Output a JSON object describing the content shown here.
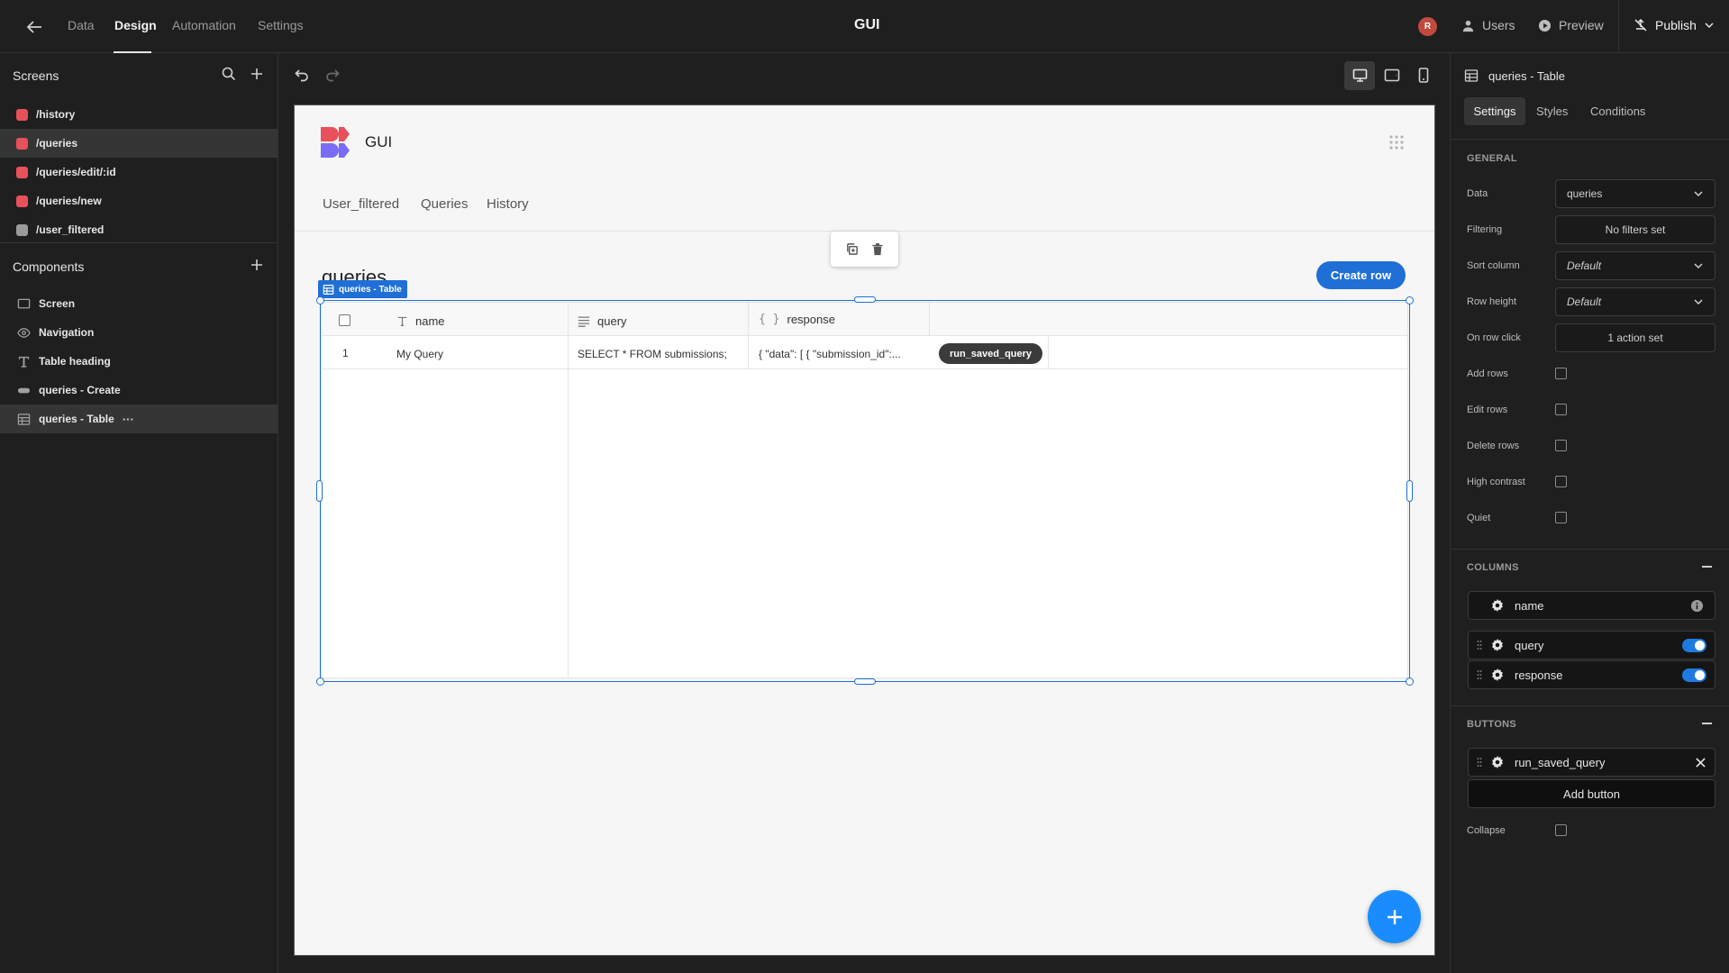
{
  "topbar": {
    "tabs": [
      "Data",
      "Design",
      "Automation",
      "Settings"
    ],
    "title": "GUI",
    "avatar": "R",
    "users": "Users",
    "preview": "Preview",
    "publish": "Publish"
  },
  "screens": {
    "title": "Screens",
    "items": [
      "/history",
      "/queries",
      "/queries/edit/:id",
      "/queries/new",
      "/user_filtered"
    ],
    "colors": [
      "#e8505b",
      "#e8505b",
      "#e8505b",
      "#e8505b",
      "#9a9a9a"
    ]
  },
  "components": {
    "title": "Components",
    "items": [
      "Screen",
      "Navigation",
      "Table heading",
      "queries - Create",
      "queries - Table"
    ],
    "more": "···"
  },
  "app": {
    "name": "GUI",
    "nav": [
      "User_filtered",
      "Queries",
      "History"
    ],
    "heading": "queries",
    "create_row": "Create row",
    "selection_tag": "queries - Table",
    "table": {
      "headers": [
        "name",
        "query",
        "response"
      ],
      "rows": [
        {
          "index": "1",
          "name": "My Query",
          "query": "SELECT * FROM submissions;",
          "response": "{ \"data\": [ { \"submission_id\":...",
          "button": "run_saved_query"
        }
      ]
    }
  },
  "panel": {
    "title": "queries - Table",
    "tabs": [
      "Settings",
      "Styles",
      "Conditions"
    ],
    "general": "GENERAL",
    "labels": {
      "data": "Data",
      "filtering": "Filtering",
      "sort_column": "Sort column",
      "row_height": "Row height",
      "on_row_click": "On row click",
      "add_rows": "Add rows",
      "edit_rows": "Edit rows",
      "delete_rows": "Delete rows",
      "high_contrast": "High contrast",
      "quiet": "Quiet",
      "collapse": "Collapse"
    },
    "values": {
      "data": "queries",
      "filtering": "No filters set",
      "sort_column": "Default",
      "row_height": "Default",
      "on_row_click": "1 action set"
    },
    "columns_title": "COLUMNS",
    "columns": [
      "name",
      "query",
      "response"
    ],
    "buttons_title": "BUTTONS",
    "buttons": [
      "run_saved_query"
    ],
    "add_button": "Add button"
  },
  "colors": {
    "accent": "#1f7ae0",
    "brand_red": "#e8505b",
    "brand_purple": "#7b6cf6"
  }
}
